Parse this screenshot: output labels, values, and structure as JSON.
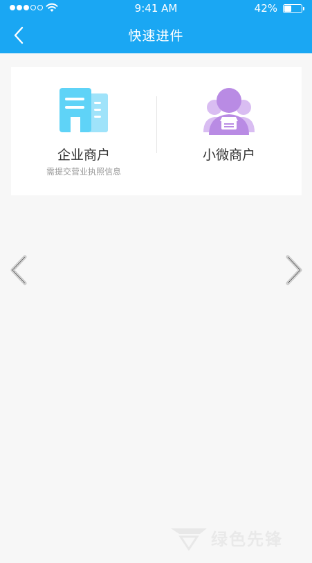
{
  "status_bar": {
    "time": "9:41 AM",
    "battery_percent": "42%",
    "battery_level": 0.42,
    "signal_bars_filled": 3,
    "signal_bars_total": 5
  },
  "nav": {
    "title": "快速进件",
    "back_icon": "chevron-left-icon"
  },
  "options": [
    {
      "title": "企业商户",
      "subtitle": "需提交营业执照信息",
      "icon": "building-icon",
      "color": "#5fd3f7"
    },
    {
      "title": "小微商户",
      "subtitle": "",
      "icon": "shop-person-icon",
      "color": "#b98be4"
    }
  ],
  "carousel": {
    "prev_icon": "chevron-left-icon",
    "next_icon": "chevron-right-icon"
  },
  "watermark": {
    "text": "绿色先锋"
  },
  "colors": {
    "header_bg": "#1aa7f3",
    "page_bg": "#f7f7f7",
    "card_bg": "#ffffff"
  }
}
